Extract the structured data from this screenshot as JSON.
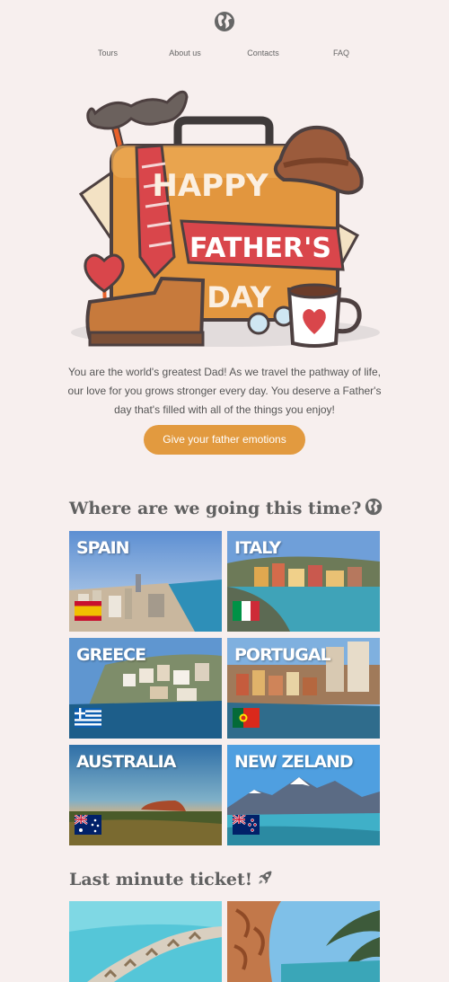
{
  "header": {
    "logo_icon": "globe-icon",
    "nav": [
      "Tours",
      "About us",
      "Contacts",
      "FAQ"
    ]
  },
  "hero": {
    "lines": [
      "HAPPY",
      "FATHER'S",
      "DAY"
    ]
  },
  "intro": {
    "text": "You are the world's greatest Dad! As we travel the pathway of life, our love for you grows stronger every day. You deserve a Father's day that's filled with all of the things you enjoy!",
    "cta_label": "Give your father emotions"
  },
  "destinations": {
    "title": "Where are we going this time?",
    "title_icon": "globe-icon",
    "items": [
      {
        "name": "SPAIN",
        "flag": "spain-flag-icon"
      },
      {
        "name": "ITALY",
        "flag": "italy-flag-icon"
      },
      {
        "name": "GREECE",
        "flag": "greece-flag-icon"
      },
      {
        "name": "PORTUGAL",
        "flag": "portugal-flag-icon"
      },
      {
        "name": "AUSTRALIA",
        "flag": "australia-flag-icon"
      },
      {
        "name": "NEW ZELAND",
        "flag": "new-zealand-flag-icon"
      }
    ]
  },
  "last_minute": {
    "title": "Last minute ticket!",
    "title_icon": "rocket-icon"
  },
  "colors": {
    "background": "#f7efee",
    "accent": "#e29a3f",
    "heading": "#606060"
  }
}
